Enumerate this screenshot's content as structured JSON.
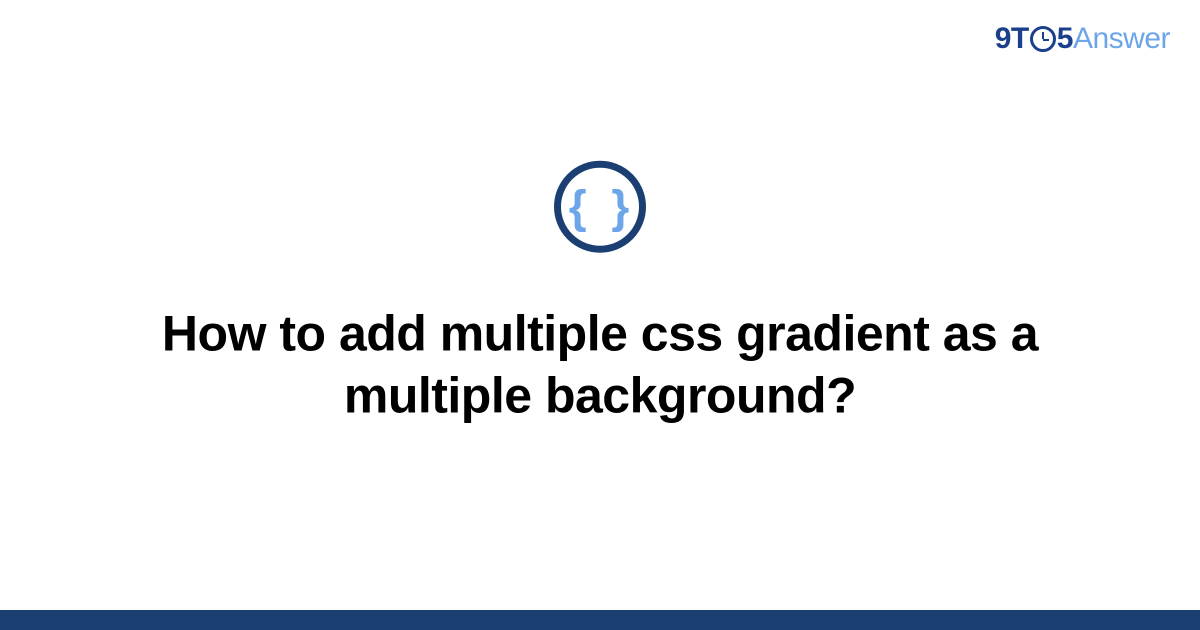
{
  "header": {
    "logo_prefix": "9T",
    "logo_suffix": "5",
    "logo_answer": "Answer"
  },
  "main": {
    "icon_glyph": "{ }",
    "title": "How to add multiple css gradient as a multiple background?"
  },
  "colors": {
    "brand_dark": "#1b3f72",
    "brand_light": "#6da6e8"
  }
}
